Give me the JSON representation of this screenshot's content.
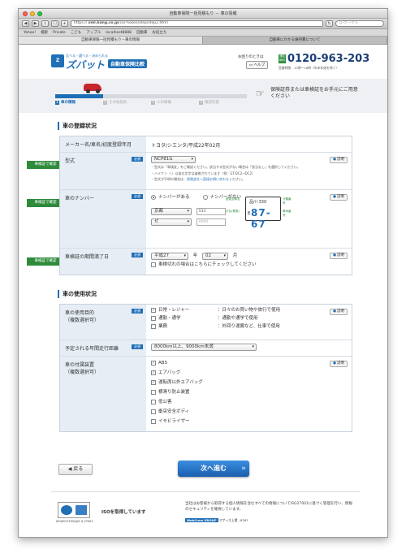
{
  "browser": {
    "title": "自動車保険一括見積もり － 車の情報",
    "url": "https://",
    "url_host": "xml.bang.co.jp",
    "url_path": "/car-hoken/step/step2.html",
    "search_placeholder": "Q-グーグル",
    "bookmarks": [
      "Yahoo!",
      "検索",
      "Private",
      "こども",
      "アップル",
      "localhost8888",
      "自動車",
      "お役立ち"
    ],
    "tabs": [
      "自動車保険一括見積もり－車の情報",
      "自動車にかかる維持費について"
    ]
  },
  "header": {
    "logo_tagline": "比べる・選べる・決められる",
    "logo_name": "ズバット",
    "logo_sub": "自動車保険比較",
    "contact_label": "お困りのときは",
    "help_button": "ヘルプ",
    "free_badge": "通話無料",
    "phone": "0120-963-203",
    "hours": "営業時間：10時～18時（年末年始を除く）"
  },
  "steps": {
    "progress_fraction": 0.25,
    "items": [
      {
        "num": "1",
        "label": "車の情報"
      },
      {
        "num": "2",
        "label": "その他契約"
      },
      {
        "num": "3",
        "label": "人の情報"
      },
      {
        "num": "4",
        "label": "確認内容"
      }
    ],
    "notice": "保険証券または車検証をお手元にご用意ください"
  },
  "vehicle": {
    "section_title": "車の登録状況",
    "maker_label": "メーカー名/車名/初度登録年月",
    "maker_value": "トヨタ/シエンタ/平成22年02月",
    "model_label": "型式",
    "model_value": "NCP81G",
    "model_note1": "・型式は「車検証」をご確認ください。該当する型式がない場合は「該当なし」を選択してください。",
    "model_note2": "・ハイフン（-）以前の文字は省略されています（例：GT-DC2→DC2）",
    "model_note3_pre": "・型式が不明の場合は、",
    "model_note3_link": "保険会社へ直接お問い合わせ",
    "model_note3_post": "ください。",
    "plate_label": "車のナンバー",
    "plate_has": "ナンバーがある",
    "plate_none": "ナンバーがない",
    "plate_region": "京都",
    "plate_class": "533",
    "plate_kana": "せ",
    "plate_number_placeholder": "0000",
    "plate_sample_top": "品川 330",
    "plate_sample_num": "87-67",
    "plate_sample_kana": "ま",
    "plate_lbl_region": "陸運支局名",
    "plate_lbl_class": "分類番号",
    "plate_lbl_kana": "かな(業態)",
    "plate_lbl_serial": "車両番号",
    "expiry_label": "車検証の期間満了日",
    "expiry_era": "平成27",
    "expiry_year_suffix": "年",
    "expiry_month": "02",
    "expiry_month_suffix": "月",
    "expiry_check": "車検切れの場合はこちらにチェックしてください",
    "required": "必須",
    "help": "説明",
    "side_tag": "車検証で確認"
  },
  "usage": {
    "section_title": "車の使用状況",
    "purpose_label": "車の使用目的",
    "purpose_sub": "（複数選択可）",
    "purposes": [
      {
        "name": "日常・レジャー",
        "desc": "：日々のお買い物や旅行で使用",
        "checked": "✓"
      },
      {
        "name": "通勤・通学",
        "desc": "：通勤や通学で使用",
        "checked": ""
      },
      {
        "name": "業務",
        "desc": "：外回り運搬など、仕事で使用",
        "checked": ""
      }
    ],
    "mileage_label": "予定される年間走行距離",
    "mileage_value": "8000km以上、9000km未満",
    "equip_label": "車の付属装置",
    "equip_sub": "（複数選択可）",
    "equipment": [
      {
        "name": "ABS",
        "checked": "✓"
      },
      {
        "name": "エアバッグ",
        "checked": "✓"
      },
      {
        "name": "運転席以外エアバッグ",
        "checked": "✓"
      },
      {
        "name": "横滑り防止装置",
        "checked": ""
      },
      {
        "name": "低公害",
        "checked": ""
      },
      {
        "name": "衝突安全ボディ",
        "checked": ""
      },
      {
        "name": "イモビライザー",
        "checked": ""
      }
    ]
  },
  "nav": {
    "back": "戻る",
    "next": "次へ進む"
  },
  "footer": {
    "iso_text": "ISOを取得しています",
    "iso_caption": "ISO/IEC27001/JIS Q 27001",
    "privacy": "当社はお客様から取得する個人情報を含むすべての情報についてISO27001に基づく管理を行い、情報のセキュリティを確保しています。",
    "webcrew": "WebCrew GROUP",
    "mark": "マザーズ上場 : 8767"
  },
  "colors": {
    "brand_blue": "#1f6fb6",
    "tag_green": "#2e8b3a",
    "car_red": "#c8252c"
  }
}
